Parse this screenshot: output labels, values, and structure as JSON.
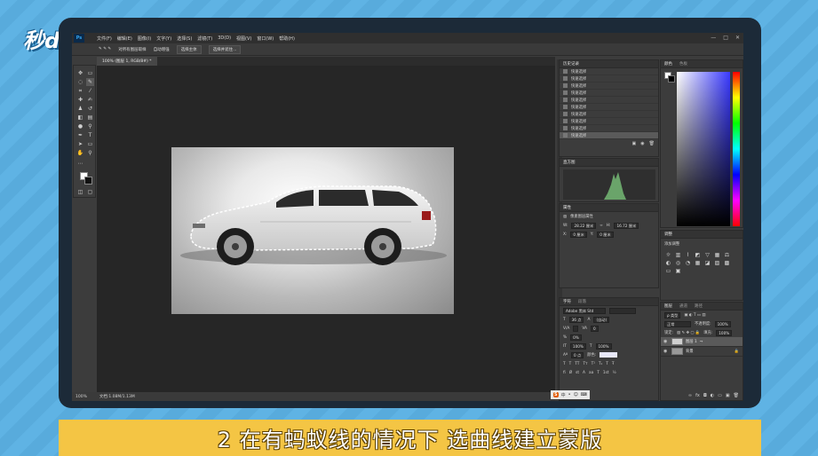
{
  "watermark": {
    "logo_text": "秒dong视频"
  },
  "app": {
    "logo": "Ps",
    "menu": [
      "文件(F)",
      "编辑(E)",
      "图像(I)",
      "文字(Y)",
      "选择(S)",
      "滤镜(T)",
      "3D(D)",
      "视图(V)",
      "窗口(W)",
      "帮助(H)"
    ],
    "window_controls": [
      "—",
      "□",
      "✕"
    ]
  },
  "options_bar": {
    "sample_all_label": "对所有图层取样",
    "enhance_label": "自动增强",
    "select_subject": "选择主体",
    "select_and_mask": "选择并遮住..."
  },
  "document": {
    "tab_title": "100% (图层 1, RGB/8#) *",
    "zoom": "100%",
    "doc_size": "文档:1.08M/1.13M"
  },
  "history_panel": {
    "tabs": [
      "历史记录"
    ],
    "rows": [
      "快速选择",
      "快速选择",
      "快速选择",
      "快速选择",
      "快速选择",
      "快速选择",
      "快速选择",
      "快速选择",
      "快速选择",
      "快速选择"
    ]
  },
  "histogram_panel": {
    "title": "直方图"
  },
  "properties_panel": {
    "title": "属性",
    "type_label": "像素图层属性",
    "w_label": "W:",
    "w_value": "28.22 厘米",
    "h_label": "H:",
    "h_value": "16.72 厘米",
    "x_label": "X:",
    "x_value": "0 厘米",
    "y_label": "Y:",
    "y_value": "0 厘米"
  },
  "character_panel": {
    "tabs": [
      "字符",
      "段落"
    ],
    "font": "Adobe 黑体 Std",
    "size": "36 点",
    "leading": "(自动)",
    "tracking": "0",
    "scale_v": "100%",
    "scale_h": "100%",
    "baseline": "0 点",
    "color_label": "颜色:",
    "percent": "0%",
    "lang": "美国英语",
    "aa": "锐利"
  },
  "color_panel": {
    "tabs": [
      "颜色",
      "色板"
    ]
  },
  "adjustments_panel": {
    "tabs": [
      "调整"
    ],
    "hint": "添加调整"
  },
  "layers_panel": {
    "tabs": [
      "图层",
      "通道",
      "路径"
    ],
    "kind": "ρ 类型",
    "blend": "正常",
    "opacity_label": "不透明度:",
    "opacity": "100%",
    "lock_label": "锁定:",
    "fill_label": "填充:",
    "fill": "100%",
    "layers": [
      {
        "name": "图层 1",
        "selected": true
      },
      {
        "name": "背景",
        "selected": false
      }
    ]
  },
  "ime": {
    "label": "S",
    "items": [
      "中",
      "•",
      "☺",
      "⌨"
    ]
  },
  "caption": {
    "text": "2 在有蚂蚁线的情况下 选曲线建立蒙版"
  },
  "colors": {
    "caption_bg": "#f4c544",
    "ps_bg": "#3c3c3c",
    "canvas_bg": "#262626",
    "page_bg": "#5aaee0"
  }
}
